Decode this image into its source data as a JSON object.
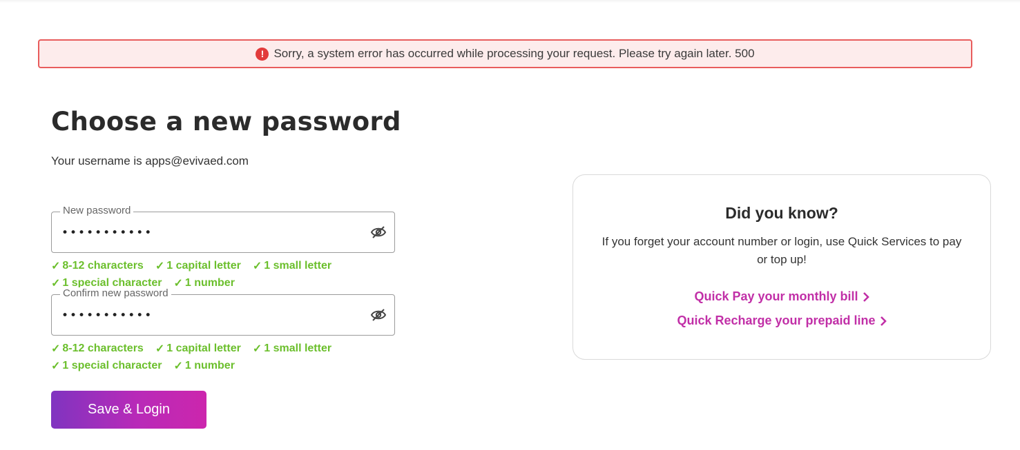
{
  "alert": {
    "icon": "exclamation-circle-icon",
    "icon_glyph": "!",
    "message": "Sorry, a system error has occurred while processing your request. Please try again later. 500",
    "color": "#e85c5c"
  },
  "page": {
    "title": "Choose a new password",
    "username_text": "Your username is apps@evivaed.com"
  },
  "new_password": {
    "label": "New password",
    "value": "•••••••••••",
    "toggle_icon": "eye-slash-icon",
    "rules_line1": [
      "8-12 characters",
      "1 capital letter",
      "1 small letter"
    ],
    "rules_line2": [
      "1 special character",
      "1 number"
    ]
  },
  "confirm_password": {
    "label": "Confirm new password",
    "value": "•••••••••••",
    "toggle_icon": "eye-slash-icon",
    "rules_line1": [
      "8-12 characters",
      "1 capital letter",
      "1 small letter"
    ],
    "rules_line2": [
      "1 special character",
      "1 number"
    ]
  },
  "rule_color": "#6bbf2c",
  "save_button": {
    "label": "Save & Login",
    "gradient": [
      "#8034c0",
      "#cc26ad"
    ]
  },
  "info_card": {
    "title": "Did you know?",
    "text": "If you forget your account number or login, use Quick Services to pay or top up!",
    "links": [
      {
        "label": "Quick Pay your monthly bill"
      },
      {
        "label": "Quick Recharge your prepaid line"
      }
    ],
    "link_color": "#c12fa7"
  }
}
